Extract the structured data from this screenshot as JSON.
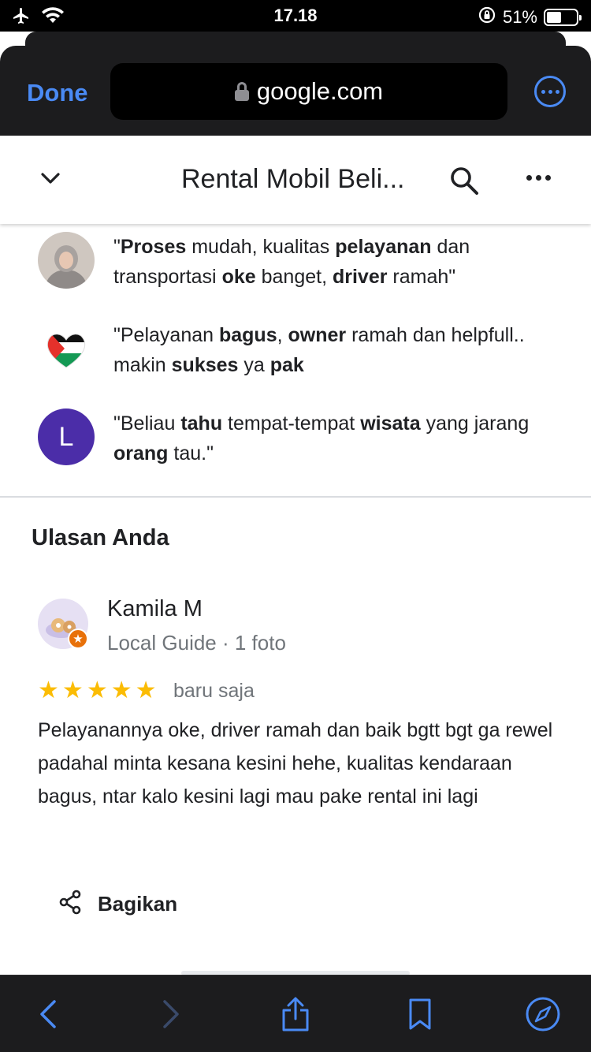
{
  "status_bar": {
    "time": "17.18",
    "battery_percent": "51%",
    "battery_level": 0.51
  },
  "safari": {
    "done_label": "Done",
    "url": "google.com"
  },
  "header": {
    "title": "Rental Mobil Beli..."
  },
  "snippets": [
    {
      "parts": [
        [
          "\"",
          false
        ],
        [
          "Proses",
          true
        ],
        [
          " mudah, kualitas ",
          false
        ],
        [
          "pelayanan",
          true
        ],
        [
          " dan transportasi ",
          false
        ],
        [
          "oke",
          true
        ],
        [
          " banget, ",
          false
        ],
        [
          "driver",
          true
        ],
        [
          " ramah\"",
          false
        ]
      ]
    },
    {
      "parts": [
        [
          "\"Pelayanan ",
          false
        ],
        [
          "bagus",
          true
        ],
        [
          ", ",
          false
        ],
        [
          "owner",
          true
        ],
        [
          " ramah dan helpfull.. makin ",
          false
        ],
        [
          "sukses",
          true
        ],
        [
          " ya ",
          false
        ],
        [
          "pak",
          true
        ]
      ]
    },
    {
      "avatar_letter": "L",
      "parts": [
        [
          "\"Beliau ",
          false
        ],
        [
          "tahu",
          true
        ],
        [
          " tempat-tempat ",
          false
        ],
        [
          "wisata",
          true
        ],
        [
          " yang jarang ",
          false
        ],
        [
          "orang",
          true
        ],
        [
          " tau.\"",
          false
        ]
      ]
    }
  ],
  "your_review": {
    "section_title": "Ulasan Anda",
    "author": "Kamila M",
    "meta": "Local Guide · 1 foto",
    "rating": 5,
    "time": "baru saja",
    "text": "Pelayanannya oke, driver ramah dan baik bgtt bgt ga rewel padahal minta kesana kesini hehe, kualitas kendaraan bagus, ntar kalo kesini lagi mau pake rental ini lagi",
    "share_label": "Bagikan"
  },
  "colors": {
    "accent_blue": "#4a8af4",
    "star": "#fbbc04",
    "avatar_purple": "#4b2da8",
    "badge_orange": "#e8710a"
  },
  "icons": [
    "airplane-icon",
    "wifi-icon",
    "rotation-lock-icon",
    "battery-icon",
    "lock-icon",
    "more-circle-icon",
    "chevron-down-icon",
    "search-icon",
    "more-dots-icon",
    "share-icon",
    "back-arrow-icon",
    "forward-arrow-icon",
    "share-sheet-icon",
    "bookmark-icon",
    "compass-icon"
  ]
}
